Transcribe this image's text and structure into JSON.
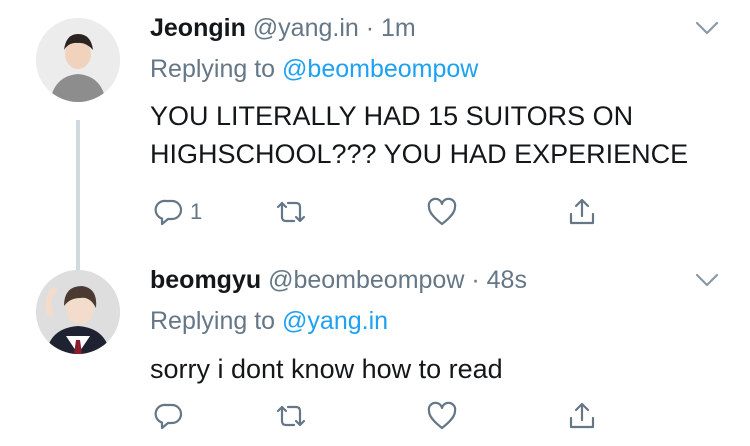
{
  "tweets": [
    {
      "display_name": "Jeongin",
      "handle": "@yang.in",
      "separator": "·",
      "time": "1m",
      "replying_prefix": "Replying to",
      "replying_to": "@beombeompow",
      "text_line1": "YOU LITERALLY HAD 15 SUITORS ON",
      "text_line2": "HIGHSCHOOL??? YOU HAD EXPERIENCE",
      "reply_count": "1"
    },
    {
      "display_name": "beomgyu",
      "handle": "@beombeompow",
      "separator": "·",
      "time": "48s",
      "replying_prefix": "Replying to",
      "replying_to": "@yang.in",
      "text_line1": "sorry i dont know how to read",
      "reply_count": ""
    }
  ],
  "icons": {
    "reply": "reply-icon",
    "retweet": "retweet-icon",
    "like": "heart-icon",
    "share": "share-icon",
    "more": "chevron-down-icon"
  },
  "colors": {
    "name": "#14171a",
    "secondary": "#657786",
    "link": "#1da1f2",
    "thread_line": "#cfd9de"
  }
}
